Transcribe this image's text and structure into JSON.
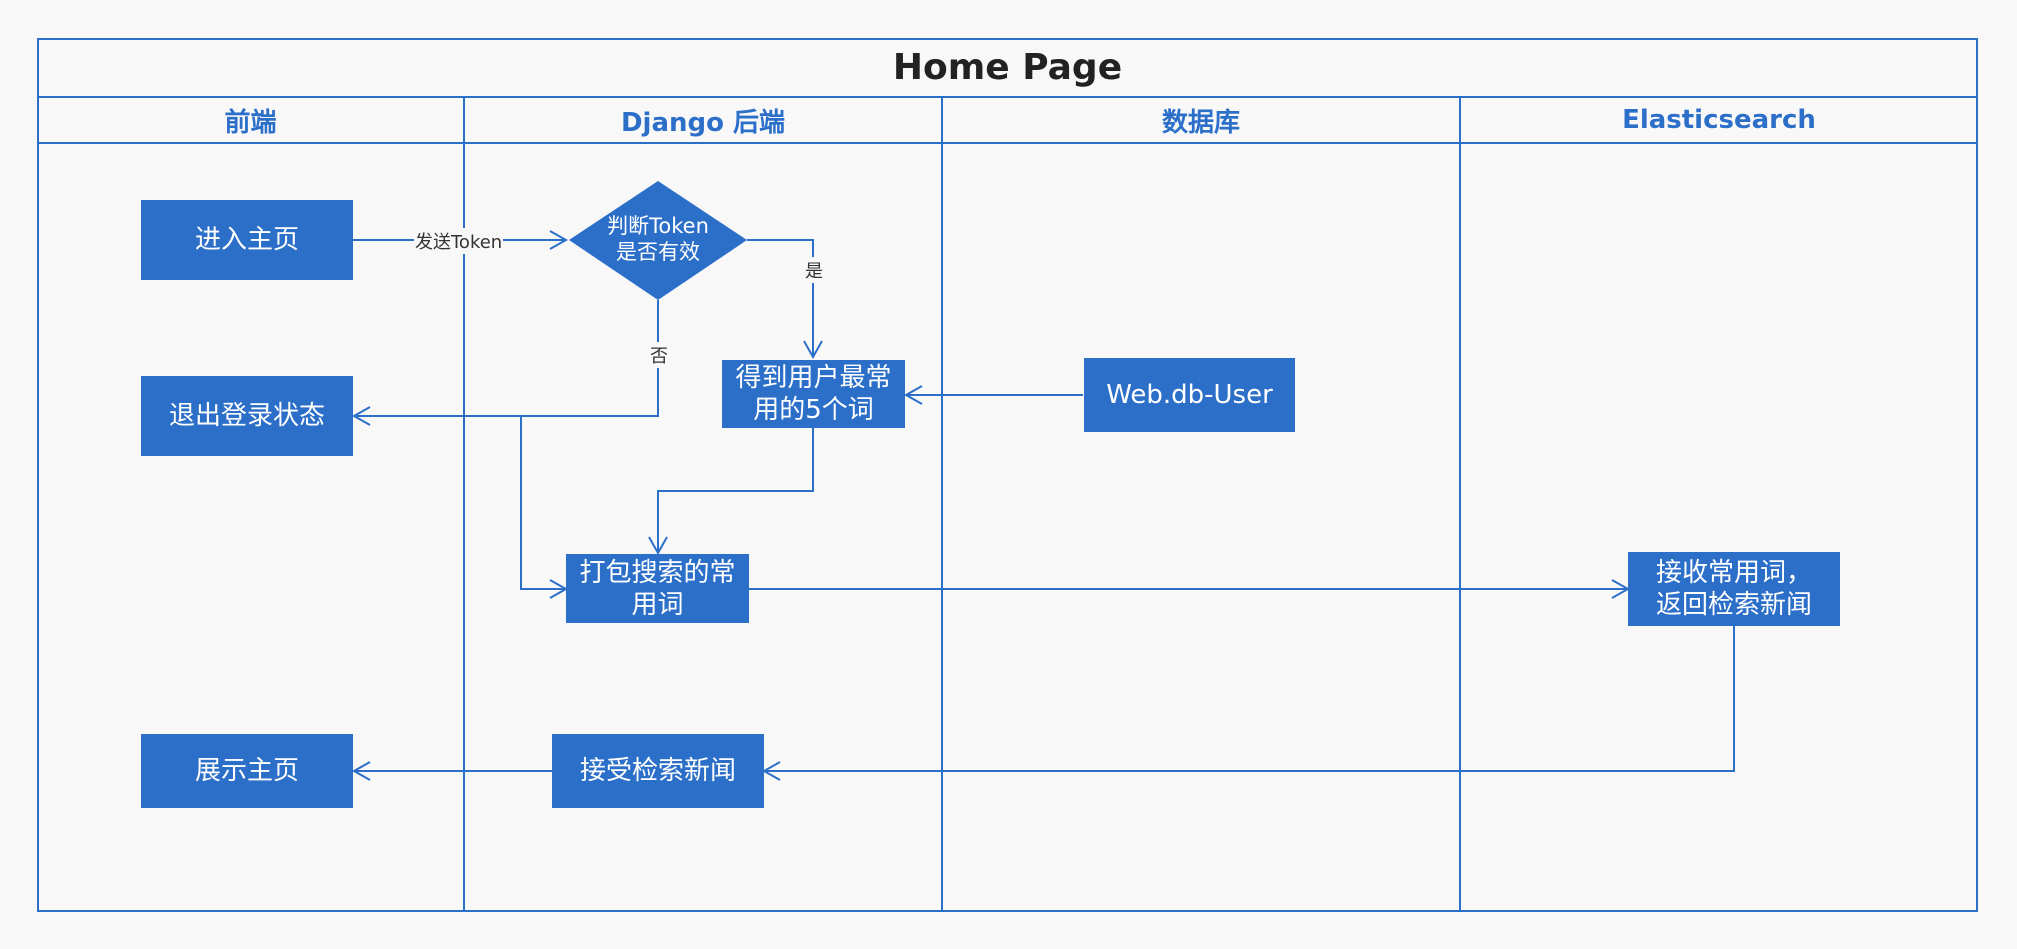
{
  "title": "Home Page",
  "lanes": [
    "前端",
    "Django 后端",
    "数据库",
    "Elasticsearch"
  ],
  "nodes": {
    "enter_home": "进入主页",
    "check_token": "判断Token\n是否有效",
    "logout_state": "退出登录状态",
    "top5_words": "得到用户最常\n用的5个词",
    "web_db_user": "Web.db-User",
    "pack_words": "打包搜索的常\n用词",
    "receive_words": "接收常用词，\n返回检索新闻",
    "accept_news": "接受检索新闻",
    "show_home": "展示主页"
  },
  "edge_labels": {
    "send_token": "发送Token",
    "yes": "是",
    "no": "否"
  },
  "colors": {
    "accent": "#2c6fc9",
    "background": "#f8f8f9"
  }
}
